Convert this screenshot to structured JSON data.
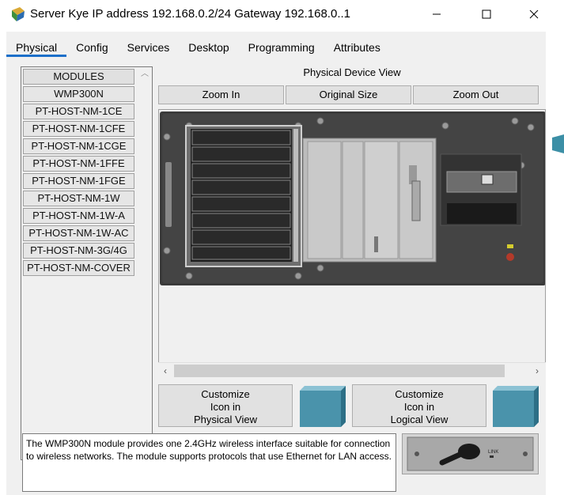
{
  "window": {
    "title": "Server Kye IP address 192.168.0.2/24 Gateway 192.168.0..1",
    "minimize_icon": "minimize-icon",
    "maximize_icon": "maximize-icon",
    "close_icon": "close-icon"
  },
  "tabs": [
    {
      "label": "Physical",
      "active": true
    },
    {
      "label": "Config"
    },
    {
      "label": "Services"
    },
    {
      "label": "Desktop"
    },
    {
      "label": "Programming"
    },
    {
      "label": "Attributes"
    }
  ],
  "modules": [
    "MODULES",
    "WMP300N",
    "PT-HOST-NM-1CE",
    "PT-HOST-NM-1CFE",
    "PT-HOST-NM-1CGE",
    "PT-HOST-NM-1FFE",
    "PT-HOST-NM-1FGE",
    "PT-HOST-NM-1W",
    "PT-HOST-NM-1W-A",
    "PT-HOST-NM-1W-AC",
    "PT-HOST-NM-3G/4G",
    "PT-HOST-NM-COVER"
  ],
  "physical_view": {
    "label": "Physical Device View",
    "zoom_in": "Zoom In",
    "original_size": "Original Size",
    "zoom_out": "Zoom Out"
  },
  "customize": {
    "physical_lines": [
      "Customize",
      "Icon in",
      "Physical View"
    ],
    "logical_lines": [
      "Customize",
      "Icon in",
      "Logical View"
    ]
  },
  "description": "The WMP300N module provides one 2.4GHz wireless interface suitable for connection to wireless networks. The module supports protocols that use Ethernet for LAN access.",
  "module_thumb_label": "LINK",
  "colors": {
    "tab_accent": "#1c6fc9",
    "chassis": "#3c3c3c",
    "cube": "#4a93ab"
  }
}
